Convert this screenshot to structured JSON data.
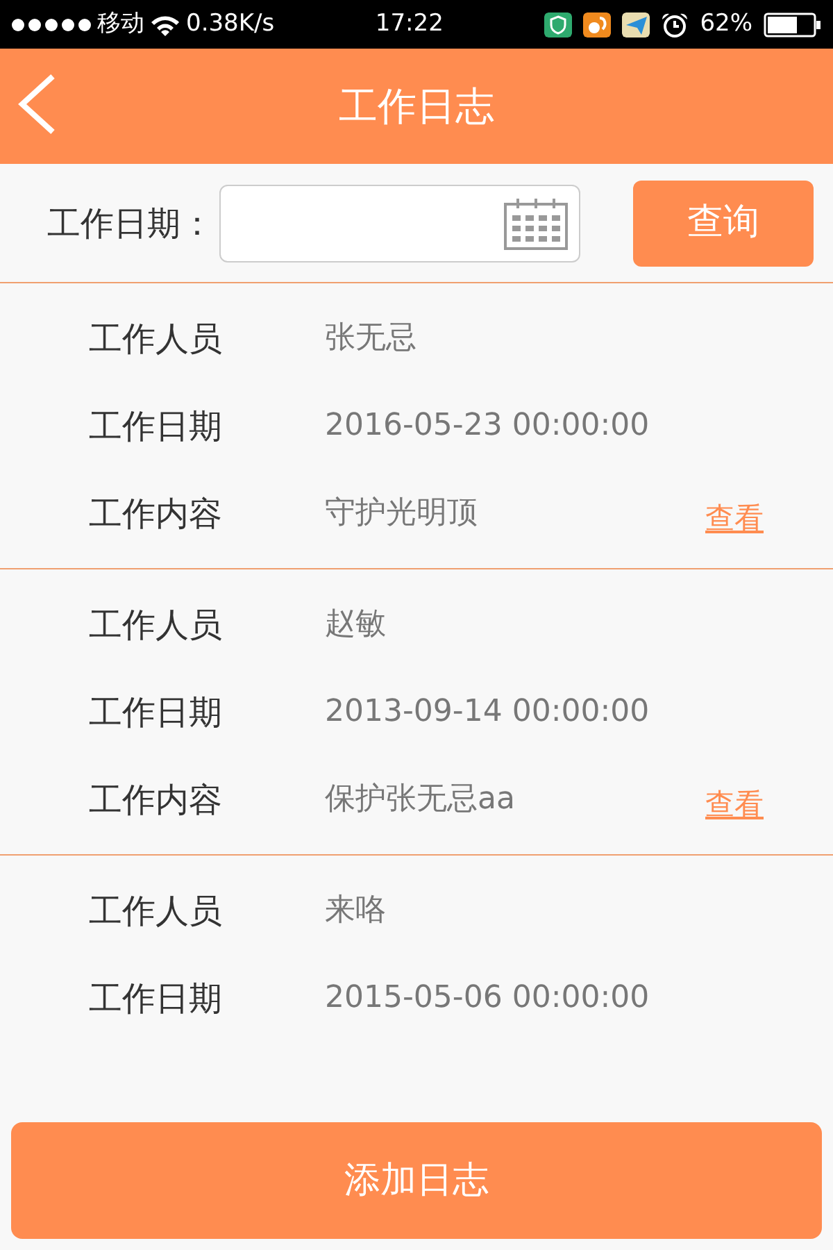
{
  "status_bar": {
    "carrier": "移动",
    "speed": "0.38K/s",
    "time": "17:22",
    "battery": "62%"
  },
  "header": {
    "title": "工作日志"
  },
  "search": {
    "label": "工作日期：",
    "button": "查询"
  },
  "records": [
    {
      "fields": [
        {
          "label": "工作人员",
          "value": "张无忌"
        },
        {
          "label": "工作日期",
          "value": "2016-05-23 00:00:00"
        },
        {
          "label": "工作内容",
          "value": "守护光明顶",
          "link": "查看"
        }
      ]
    },
    {
      "fields": [
        {
          "label": "工作人员",
          "value": "赵敏"
        },
        {
          "label": "工作日期",
          "value": "2013-09-14 00:00:00"
        },
        {
          "label": "工作内容",
          "value": "保护张无忌aa",
          "link": "查看"
        }
      ]
    },
    {
      "fields": [
        {
          "label": "工作人员",
          "value": "来咯"
        },
        {
          "label": "工作日期",
          "value": "2015-05-06 00:00:00"
        }
      ]
    }
  ],
  "add_button": "添加日志"
}
